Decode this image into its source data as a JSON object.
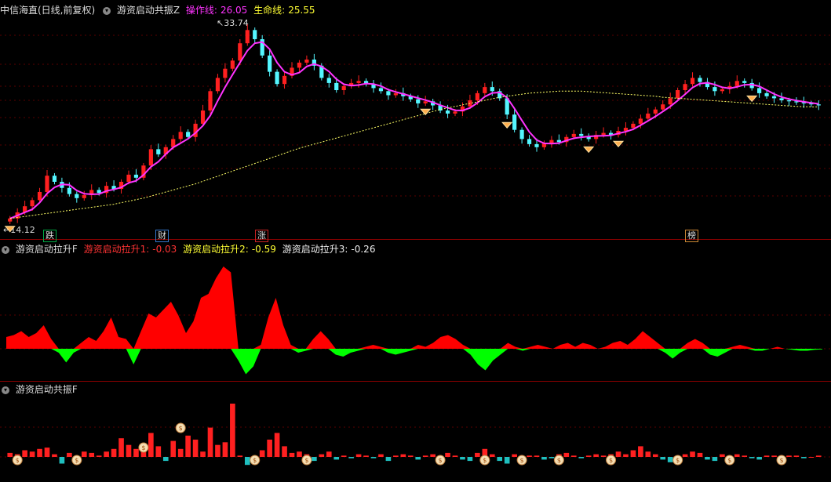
{
  "header_main": {
    "symbol": "中信海直(日线,前复权)",
    "indicator": "游资启动共振Z",
    "line1_label": "操作线:",
    "line1_value": "26.05",
    "line2_label": "生命线:",
    "line2_value": "25.55"
  },
  "header_mid": {
    "indicator": "游资启动拉升F",
    "s1_label": "游资启动拉升1:",
    "s1_value": "-0.03",
    "s2_label": "游资启动拉升2:",
    "s2_value": "-0.59",
    "s3_label": "游资启动拉升3:",
    "s3_value": "-0.26"
  },
  "header_bot": {
    "indicator": "游资启动共振F"
  },
  "price_labels": {
    "high": "33.74",
    "low": "14.12"
  },
  "tags": [
    {
      "text": "跌",
      "color": "#00ff66"
    },
    {
      "text": "财",
      "color": "#55aaff"
    },
    {
      "text": "涨",
      "color": "#ff3333"
    },
    {
      "text": "榜",
      "color": "#ffcc66"
    }
  ],
  "colors": {
    "up": "#ff2020",
    "down": "#54f6ff",
    "ma": "#ff33ff",
    "life": "#ffff66",
    "bull_area": "#ff0000",
    "bear_area": "#00ff00",
    "sep": "#8b0000",
    "grid": "#5a0000",
    "text_red": "#ff3333",
    "text_yellow": "#ffff33",
    "text_white": "#eeeeee"
  },
  "chart_data": [
    {
      "type": "candlestick",
      "title": "中信海直(日线,前复权)",
      "ylim": [
        14.12,
        33.74
      ],
      "closes": [
        14.6,
        15.2,
        15.8,
        16.4,
        17.2,
        18.8,
        18.2,
        17.6,
        17.0,
        16.6,
        16.9,
        17.4,
        17.1,
        17.8,
        17.5,
        18.2,
        18.9,
        18.6,
        19.8,
        21.4,
        20.9,
        21.6,
        22.4,
        23.1,
        22.6,
        23.9,
        25.2,
        27.1,
        28.4,
        29.3,
        30.1,
        31.8,
        33.1,
        32.2,
        30.6,
        29.0,
        27.8,
        28.6,
        29.4,
        29.9,
        30.2,
        29.6,
        28.4,
        27.9,
        27.2,
        27.6,
        27.9,
        28.1,
        27.8,
        27.4,
        27.1,
        26.7,
        26.9,
        26.6,
        26.3,
        25.9,
        26.1,
        25.7,
        25.2,
        24.9,
        25.1,
        25.6,
        26.2,
        26.9,
        27.5,
        27.1,
        26.4,
        24.8,
        23.3,
        22.4,
        21.9,
        21.6,
        22.0,
        22.3,
        22.1,
        22.6,
        22.9,
        22.7,
        22.4,
        22.8,
        23.0,
        22.8,
        23.2,
        23.5,
        23.9,
        24.4,
        24.9,
        25.3,
        25.8,
        26.4,
        27.2,
        27.8,
        28.4,
        28.0,
        27.5,
        27.1,
        27.3,
        27.6,
        28.1,
        27.9,
        27.4,
        26.9,
        26.6,
        26.4,
        26.2,
        26.1,
        26.0,
        25.9,
        25.8,
        25.7
      ],
      "life_line": [
        14.6,
        14.7,
        14.8,
        14.9,
        15.0,
        15.1,
        15.2,
        15.3,
        15.4,
        15.5,
        15.6,
        15.7,
        15.8,
        15.9,
        16.0,
        16.15,
        16.3,
        16.45,
        16.6,
        16.8,
        17.0,
        17.2,
        17.4,
        17.6,
        17.8,
        18.0,
        18.25,
        18.5,
        18.75,
        19.0,
        19.25,
        19.5,
        19.75,
        20.0,
        20.25,
        20.5,
        20.75,
        21.0,
        21.25,
        21.5,
        21.7,
        21.9,
        22.1,
        22.3,
        22.5,
        22.7,
        22.9,
        23.1,
        23.3,
        23.5,
        23.7,
        23.9,
        24.1,
        24.3,
        24.5,
        24.7,
        24.9,
        25.1,
        25.3,
        25.45,
        25.6,
        25.75,
        25.9,
        26.05,
        26.2,
        26.35,
        26.5,
        26.6,
        26.7,
        26.8,
        26.9,
        26.95,
        27.0,
        27.05,
        27.1,
        27.1,
        27.1,
        27.1,
        27.05,
        27.0,
        26.95,
        26.9,
        26.85,
        26.8,
        26.75,
        26.7,
        26.65,
        26.6,
        26.5,
        26.45,
        26.4,
        26.35,
        26.3,
        26.25,
        26.2,
        26.15,
        26.1,
        26.05,
        26.0,
        25.95,
        25.9,
        25.85,
        25.8,
        25.75,
        25.7,
        25.65,
        25.6,
        25.58,
        25.56,
        25.55
      ],
      "series": [
        {
          "name": "操作线"
        },
        {
          "name": "生命线"
        }
      ]
    },
    {
      "type": "area",
      "title": "游资启动拉升F",
      "ylim": [
        -1.5,
        4.5
      ],
      "values": [
        0.6,
        0.7,
        0.9,
        0.6,
        0.8,
        1.2,
        0.5,
        -0.2,
        -0.7,
        -0.2,
        0.3,
        0.6,
        0.4,
        0.9,
        1.6,
        0.6,
        0.5,
        -0.8,
        0.9,
        1.8,
        1.6,
        2.0,
        2.4,
        1.7,
        0.8,
        1.4,
        2.6,
        2.8,
        3.6,
        4.2,
        3.9,
        -0.6,
        -1.3,
        -0.9,
        0.2,
        1.6,
        2.6,
        1.2,
        0.2,
        -0.2,
        -0.1,
        0.5,
        0.9,
        0.5,
        -0.3,
        -0.4,
        -0.2,
        -0.1,
        0.1,
        0.2,
        0.1,
        -0.2,
        -0.3,
        -0.2,
        -0.1,
        0.2,
        0.1,
        0.3,
        0.6,
        0.7,
        0.5,
        0.2,
        -0.3,
        -0.8,
        -1.1,
        -0.6,
        -0.3,
        0.3,
        0.1,
        -0.1,
        0.1,
        0.2,
        0.1,
        0.0,
        0.2,
        0.3,
        0.1,
        0.3,
        0.2,
        0.0,
        0.1,
        0.3,
        0.4,
        0.2,
        0.5,
        0.9,
        0.6,
        0.3,
        -0.2,
        -0.5,
        -0.2,
        0.3,
        0.5,
        0.3,
        -0.3,
        -0.4,
        -0.2,
        0.1,
        0.2,
        0.1,
        -0.1,
        -0.1,
        0.0,
        0.1,
        0.0,
        -0.05,
        -0.1,
        -0.1,
        -0.05,
        -0.03
      ]
    },
    {
      "type": "bar",
      "title": "游资启动共振F",
      "ylim": [
        -1.2,
        4.0
      ],
      "values": [
        0.3,
        0.2,
        0.5,
        0.4,
        0.6,
        0.7,
        0.2,
        -0.5,
        0.3,
        -0.2,
        0.4,
        0.3,
        0.1,
        0.4,
        0.6,
        1.4,
        0.9,
        0.6,
        0.7,
        1.8,
        0.8,
        -0.3,
        1.2,
        0.6,
        1.6,
        1.3,
        0.4,
        2.2,
        0.9,
        1.1,
        4.0,
        0.1,
        -0.6,
        -0.4,
        0.5,
        1.3,
        1.8,
        0.8,
        0.3,
        0.4,
        0.2,
        -0.3,
        0.2,
        0.4,
        -0.2,
        0.1,
        -0.1,
        0.2,
        0.1,
        -0.1,
        0.2,
        -0.3,
        0.1,
        0.2,
        0.1,
        -0.2,
        0.1,
        0.2,
        0.1,
        0.3,
        0.1,
        -0.2,
        -0.3,
        0.3,
        0.6,
        0.2,
        -0.3,
        -0.5,
        0.2,
        -0.2,
        0.1,
        0.1,
        -0.2,
        -0.1,
        0.2,
        0.3,
        0.1,
        -0.1,
        0.1,
        0.2,
        0.1,
        0.2,
        0.4,
        0.2,
        0.5,
        0.8,
        0.4,
        0.2,
        -0.2,
        -0.4,
        -0.3,
        0.2,
        0.4,
        0.3,
        -0.2,
        -0.3,
        0.2,
        0.1,
        0.2,
        0.1,
        -0.1,
        -0.2,
        0.1,
        0.1,
        0.0,
        0.1,
        0.1,
        -0.1,
        0.0,
        0.1
      ]
    }
  ]
}
